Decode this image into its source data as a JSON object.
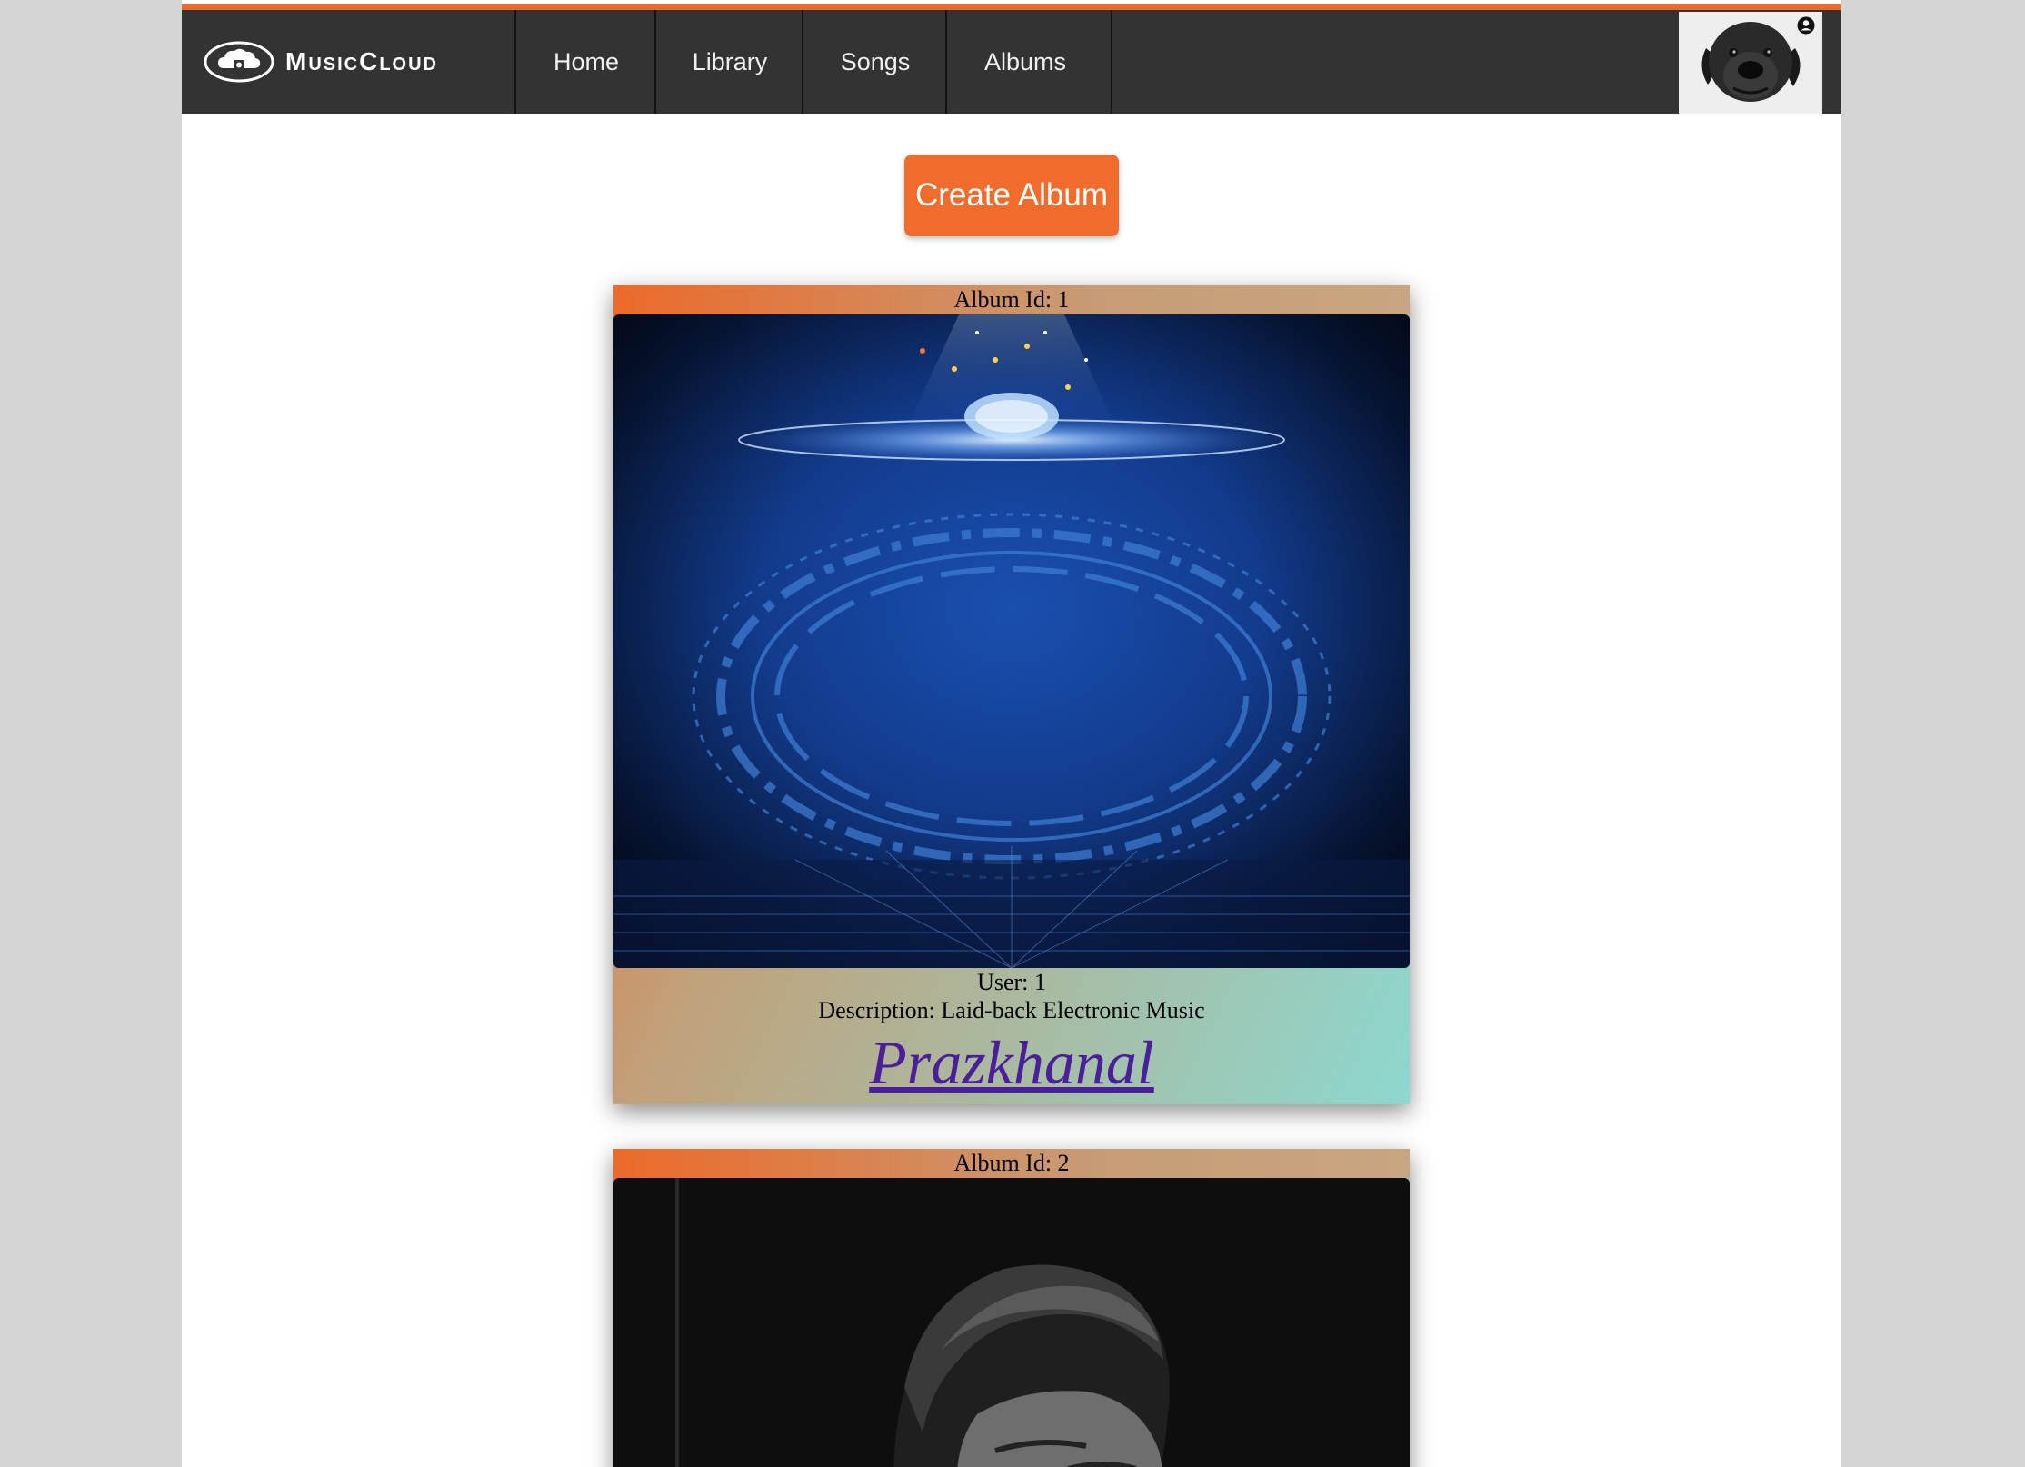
{
  "app": {
    "brand_name": "MusicCloud",
    "accent_color": "#ec6a2a",
    "navbar_color": "#333333"
  },
  "nav": {
    "items": [
      {
        "label": "Home"
      },
      {
        "label": "Library"
      },
      {
        "label": "Songs"
      },
      {
        "label": "Albums"
      }
    ]
  },
  "user_menu": {
    "avatar_icon": "dog-avatar",
    "badge_icon": "user-circle-icon"
  },
  "actions": {
    "create_album_label": "Create Album"
  },
  "albums": [
    {
      "id_label": "Album Id: 1",
      "user_label": "User: 1",
      "description_label": "Description: Laid-back Electronic Music",
      "name": "Prazkhanal",
      "cover_icon": "electronic-brain-circle-artwork"
    },
    {
      "id_label": "Album Id: 2",
      "cover_icon": "black-and-white-portrait-photo"
    }
  ]
}
